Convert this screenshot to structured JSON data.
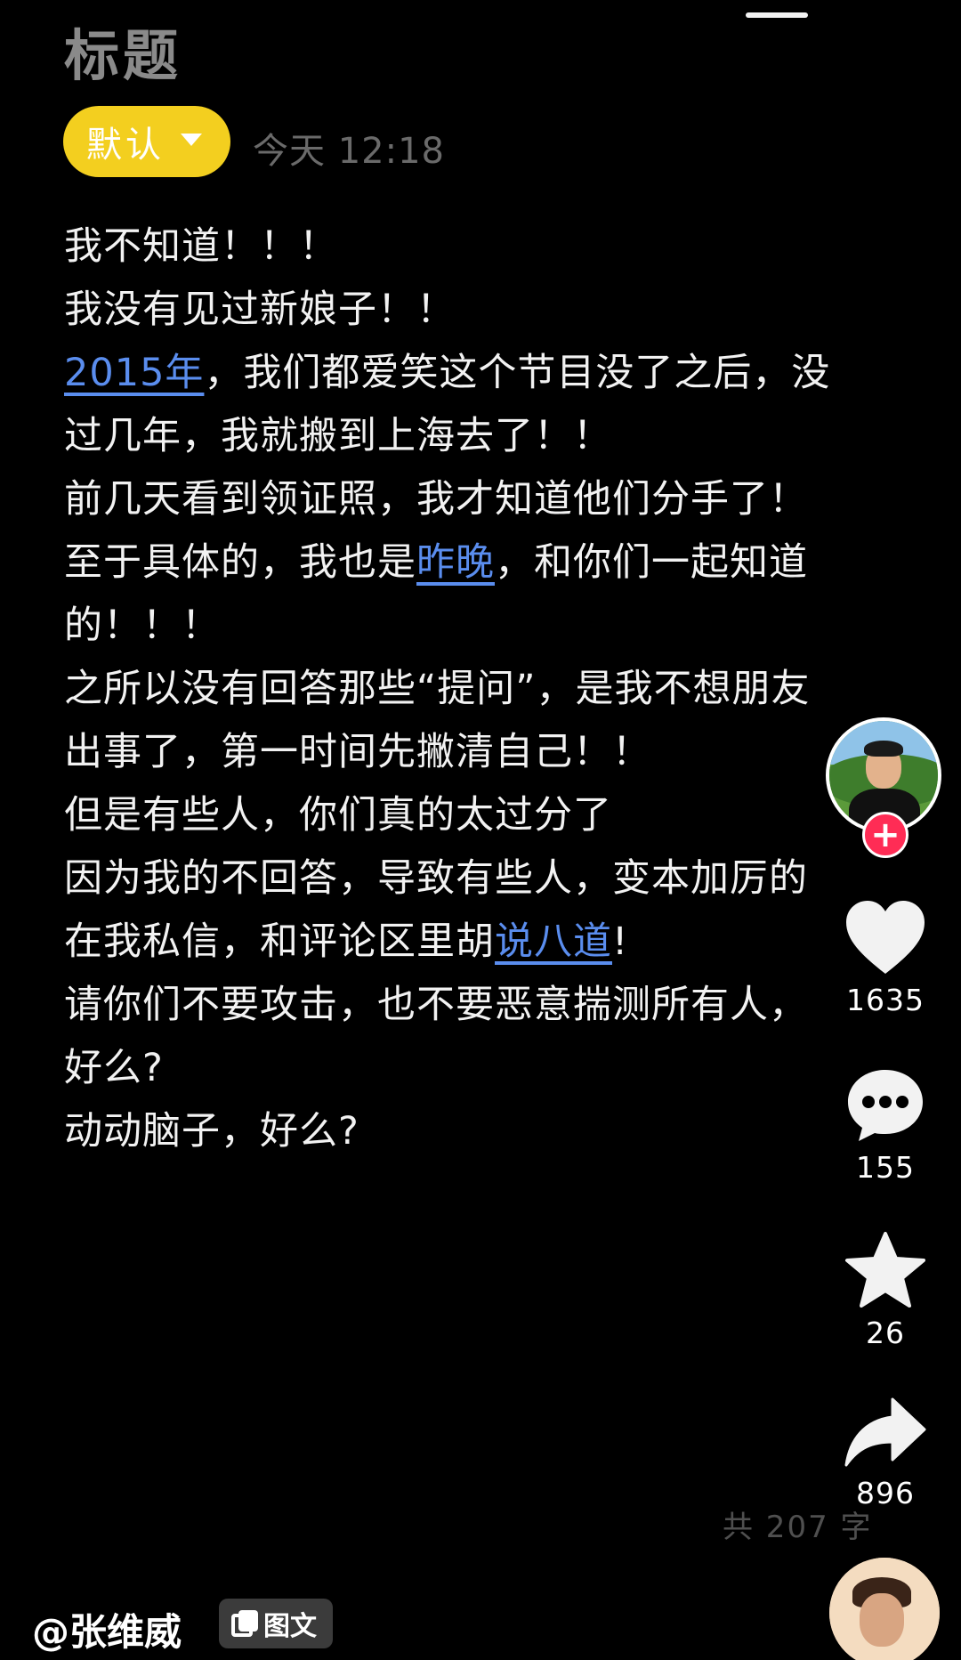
{
  "note": {
    "title": "标题",
    "category": "默认",
    "timestamp": "今天 12:18",
    "body_lines": [
      [
        {
          "text": "我不知道！！！"
        }
      ],
      [
        {
          "text": "我没有见过新娘子！！"
        }
      ],
      [
        {
          "text": "2015年",
          "link": true
        },
        {
          "text": "，我们都爱笑这个节目没了之后，没"
        }
      ],
      [
        {
          "text": "过几年，我就搬到上海去了！！"
        }
      ],
      [
        {
          "text": "前几天看到领证照，我才知道他们分手了！"
        }
      ],
      [
        {
          "text": "至于具体的，我也是"
        },
        {
          "text": "昨晚",
          "link": true
        },
        {
          "text": "，和你们一起知道"
        }
      ],
      [
        {
          "text": "的！！！"
        }
      ],
      [
        {
          "text": "之所以没有回答那些“提问”，是我不想朋友"
        }
      ],
      [
        {
          "text": "出事了，第一时间先撇清自己！！"
        }
      ],
      [
        {
          "text": "但是有些人，你们真的太过分了"
        }
      ],
      [
        {
          "text": "因为我的不回答，导致有些人，变本加厉的"
        }
      ],
      [
        {
          "text": "在我私信，和评论区里胡"
        },
        {
          "text": "说八道",
          "link": true
        },
        {
          "text": "!"
        }
      ],
      [
        {
          "text": "请你们不要攻击，也不要恶意揣测所有人，"
        }
      ],
      [
        {
          "text": "好么?"
        }
      ],
      [
        {
          "text": "动动脑子，好么?"
        }
      ]
    ],
    "word_count": "共 207 字"
  },
  "actions": {
    "likes": "1635",
    "comments": "155",
    "favorites": "26",
    "shares": "896",
    "follow_symbol": "+"
  },
  "author": {
    "handle": "@张维威",
    "content_type": "图文"
  },
  "colors": {
    "background": "#000000",
    "pill": "#f3cf1f",
    "link": "#5a8dee",
    "follow": "#ff2c55"
  }
}
